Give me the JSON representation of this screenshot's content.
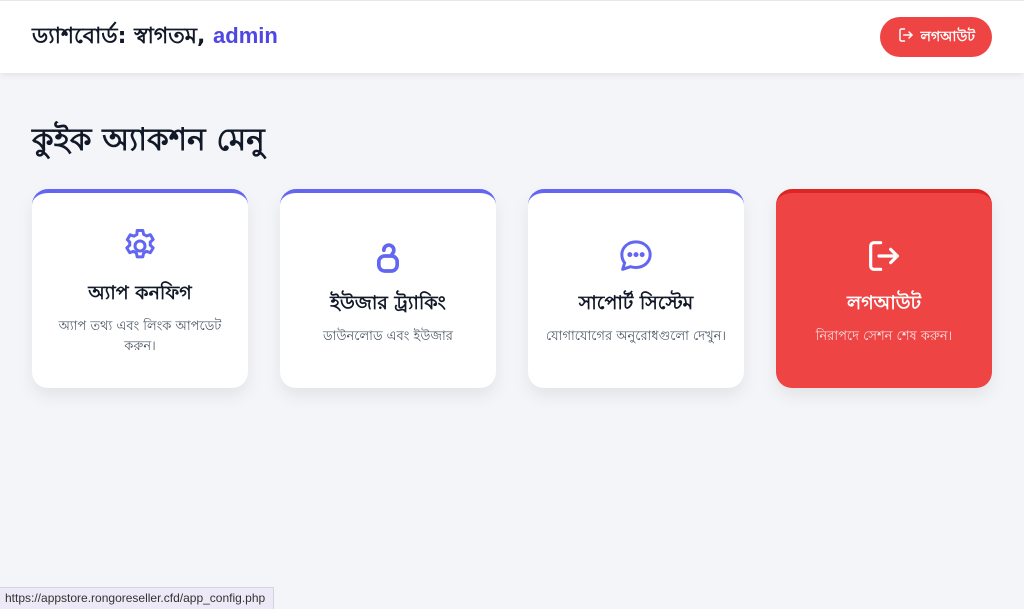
{
  "header": {
    "title_prefix": "ড্যাশবোর্ড: স্বাগতম, ",
    "username": "admin",
    "logout_label": "লগআউট",
    "logout_icon": "logout-icon"
  },
  "main": {
    "heading": "কুইক অ্যাকশন মেনু",
    "cards": [
      {
        "title": "অ্যাপ কনফিগ",
        "description": "অ্যাপ তথ্য এবং লিংক আপডেট করুন।",
        "icon": "gear-icon"
      },
      {
        "title": "ইউজার ট্র্যাকিং",
        "description": "ডাউনলোড এবং ইউজার",
        "icon": "user-tracking-icon"
      },
      {
        "title": "সাপোর্ট সিস্টেম",
        "description": "যোগাযোগের অনুরোধগুলো দেখুন।",
        "icon": "chat-icon"
      },
      {
        "title": "লগআউট",
        "description": "নিরাপদে সেশন শেষ করুন।",
        "icon": "logout-icon"
      }
    ]
  },
  "status_bar": {
    "url": "https://appstore.rongoreseller.cfd/app_config.php"
  },
  "colors": {
    "accent": "#6366f1",
    "username": "#4f46e5",
    "danger": "#ef4444",
    "background": "#f4f5f9"
  }
}
